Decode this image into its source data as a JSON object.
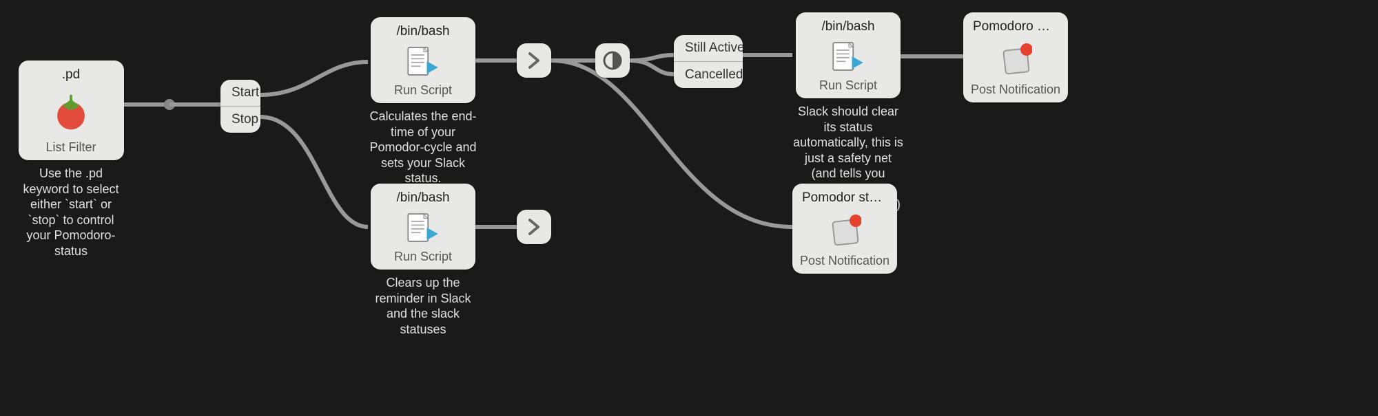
{
  "listFilter": {
    "title": ".pd",
    "subtitle": "List Filter",
    "desc": "Use the .pd keyword to select either `start` or `stop` to control your Pomodoro-status"
  },
  "switch1": {
    "row1": "Start",
    "row2": "Stop"
  },
  "script1": {
    "title": "/bin/bash",
    "subtitle": "Run Script",
    "desc": "Calculates the end-time of your Pomodor-cycle and sets your Slack status."
  },
  "script2": {
    "title": "/bin/bash",
    "subtitle": "Run Script",
    "desc": "Clears up the reminder in Slack and the slack statuses"
  },
  "switch2": {
    "row1": "Still Active",
    "row2": "Cancelled"
  },
  "script3": {
    "title": "/bin/bash",
    "subtitle": "Run Script",
    "desc": "Slack should clear its status automatically, this is just a safety net (and tells you audibly your Pomodoro is done)"
  },
  "notif1": {
    "title": "Pomodoro Done!",
    "subtitle": "Post Notification"
  },
  "notif2": {
    "title": "Pomodor started for …",
    "subtitle": "Post Notification"
  }
}
